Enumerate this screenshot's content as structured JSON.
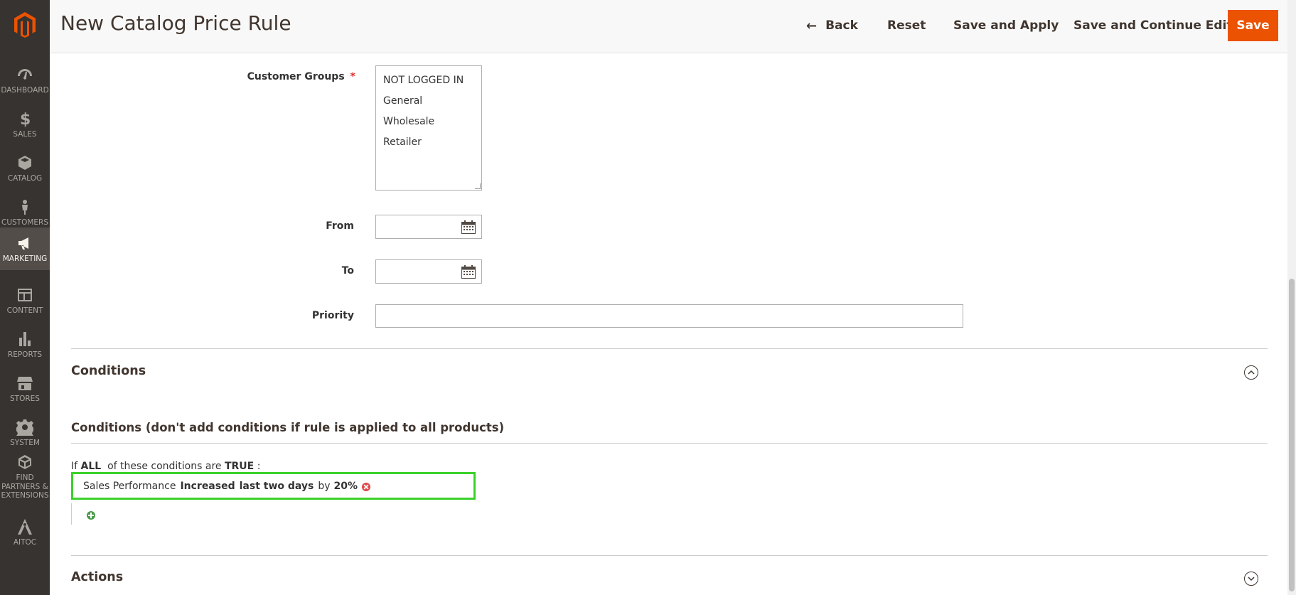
{
  "header": {
    "title": "New Catalog Price Rule",
    "back_label": "Back",
    "reset_label": "Reset",
    "save_apply_label": "Save and Apply",
    "save_continue_label": "Save and Continue Edit",
    "save_label": "Save"
  },
  "nav": {
    "items": [
      {
        "label": "DASHBOARD",
        "icon": "dashboard-icon"
      },
      {
        "label": "SALES",
        "icon": "dollar-icon"
      },
      {
        "label": "CATALOG",
        "icon": "box-icon"
      },
      {
        "label": "CUSTOMERS",
        "icon": "person-icon"
      },
      {
        "label": "MARKETING",
        "icon": "megaphone-icon",
        "active": true
      },
      {
        "label": "CONTENT",
        "icon": "layout-icon"
      },
      {
        "label": "REPORTS",
        "icon": "bar-chart-icon"
      },
      {
        "label": "STORES",
        "icon": "store-icon"
      },
      {
        "label": "SYSTEM",
        "icon": "gear-icon"
      },
      {
        "label": "FIND PARTNERS & EXTENSIONS",
        "icon": "extensions-icon"
      },
      {
        "label": "AITOC",
        "icon": "aitoc-icon"
      }
    ]
  },
  "form": {
    "customer_groups_label": "Customer Groups",
    "customer_groups_options": [
      "NOT LOGGED IN",
      "General",
      "Wholesale",
      "Retailer"
    ],
    "from_label": "From",
    "to_label": "To",
    "priority_label": "Priority",
    "required_mark": "*"
  },
  "conditions": {
    "section_title": "Conditions",
    "subtitle": "Conditions (don't add conditions if rule is applied to all products)",
    "rule_prefix": "If",
    "rule_aggregator": "ALL",
    "rule_middle": "of these conditions are",
    "rule_value": "TRUE",
    "rule_suffix": ":",
    "condition": {
      "attribute": "Sales Performance",
      "operator": "Increased",
      "period": "last two days",
      "by": "by",
      "value": "20%"
    }
  },
  "actions": {
    "section_title": "Actions"
  },
  "colors": {
    "accent": "#eb5202",
    "nav_bg": "#373330",
    "highlight": "#3bd12b"
  }
}
